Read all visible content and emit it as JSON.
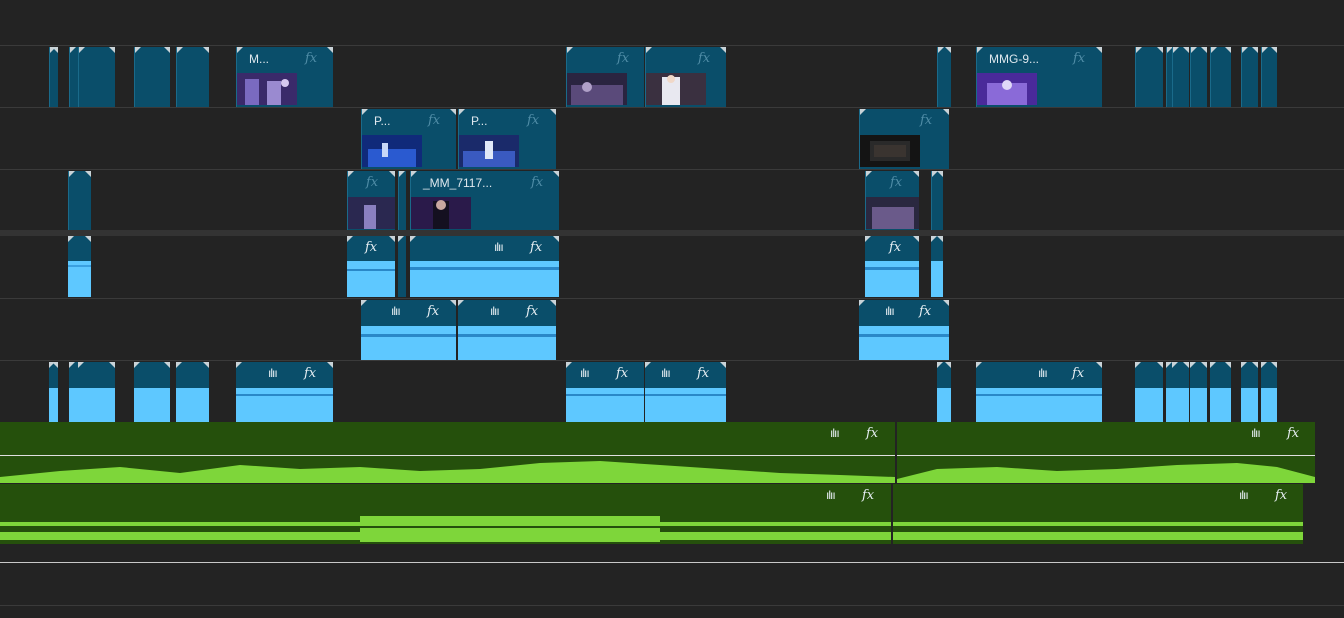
{
  "timeline": {
    "clip_labels": {
      "v3_a": "M...",
      "v3_b": "MMG-9...",
      "v2_a": "P...",
      "v2_b": "P...",
      "v1_a": "_MM_7117..."
    },
    "fx_symbol": "fx",
    "waveform_symbol": "ılıı",
    "music_marker_a": "1",
    "music_marker_b": "1"
  },
  "colors": {
    "background": "#232323",
    "video_clip": "#0a4e6a",
    "audio_wave": "#5ec8ff",
    "music_clip": "#25500c",
    "music_wave": "#7ed63a"
  }
}
